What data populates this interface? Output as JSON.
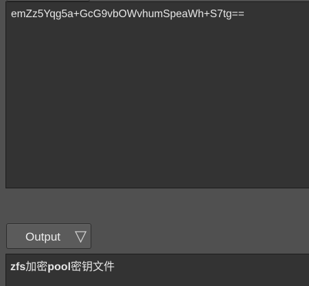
{
  "input": {
    "text": "emZz5Yqg5a+GcG9vbOWvhumSpeaWh+S7tg=="
  },
  "output_selector": {
    "label": "Output",
    "icon": "chevron-down-icon"
  },
  "output": {
    "segments": [
      "zfs",
      "加密",
      "pool",
      "密钥文件"
    ]
  }
}
